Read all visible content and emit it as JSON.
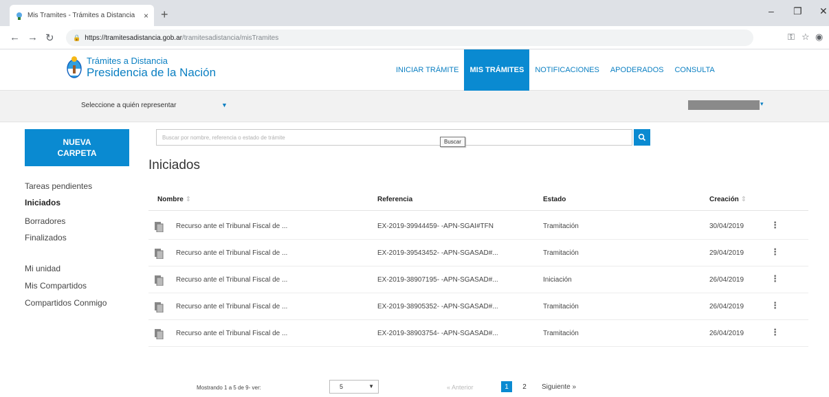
{
  "browser": {
    "tab_title": "Mis Tramites - Trámites a Distancia",
    "tab_close": "×",
    "new_tab": "+",
    "url_host": "https://tramitesadistancia.gob.ar",
    "url_path": "/tramitesadistancia/misTramites"
  },
  "header": {
    "logo_line1": "Trámites a Distancia",
    "logo_line2": "Presidencia de la Nación",
    "nav": [
      "INICIAR TRÁMITE",
      "MIS TRÁMITES",
      "NOTIFICACIONES",
      "APODERADOS",
      "CONSULTA"
    ],
    "active_nav": "MIS TRÁMITES"
  },
  "represent": {
    "label": "Seleccione a quién representar"
  },
  "sidebar": {
    "new_folder": "NUEVA\nCARPETA",
    "items": [
      "Tareas pendientes",
      "Iniciados",
      "Borradores",
      "Finalizados",
      "Mi unidad",
      "Mis Compartidos",
      "Compartidos Conmigo"
    ],
    "active": "Iniciados"
  },
  "search": {
    "placeholder": "Buscar por nombre, referencia o estado de trámite",
    "tooltip": "Buscar"
  },
  "section_title": "Iniciados",
  "table": {
    "columns": [
      "Nombre",
      "Referencia",
      "Estado",
      "Creación"
    ],
    "rows": [
      {
        "nombre": "Recurso ante el Tribunal Fiscal de ...",
        "referencia": "EX-2019-39944459- -APN-SGAI#TFN",
        "estado": "Tramitación",
        "creacion": "30/04/2019"
      },
      {
        "nombre": "Recurso ante el Tribunal Fiscal de ...",
        "referencia": "EX-2019-39543452- -APN-SGASAD#...",
        "estado": "Tramitación",
        "creacion": "29/04/2019"
      },
      {
        "nombre": "Recurso ante el Tribunal Fiscal de ...",
        "referencia": "EX-2019-38907195- -APN-SGASAD#...",
        "estado": "Iniciación",
        "creacion": "26/04/2019"
      },
      {
        "nombre": "Recurso ante el Tribunal Fiscal de ...",
        "referencia": "EX-2019-38905352- -APN-SGASAD#...",
        "estado": "Tramitación",
        "creacion": "26/04/2019"
      },
      {
        "nombre": "Recurso ante el Tribunal Fiscal de ...",
        "referencia": "EX-2019-38903754- -APN-SGASAD#...",
        "estado": "Tramitación",
        "creacion": "26/04/2019"
      }
    ]
  },
  "pagination": {
    "info": "Mostrando 1 a 5 de 9- ver:",
    "page_size": "5",
    "prev": "« Anterior",
    "pages": [
      "1",
      "2"
    ],
    "current_page": "1",
    "next": "Siguiente »"
  },
  "colors": {
    "brand": "#0a8ad1",
    "brand_text": "#0a7fc2"
  }
}
